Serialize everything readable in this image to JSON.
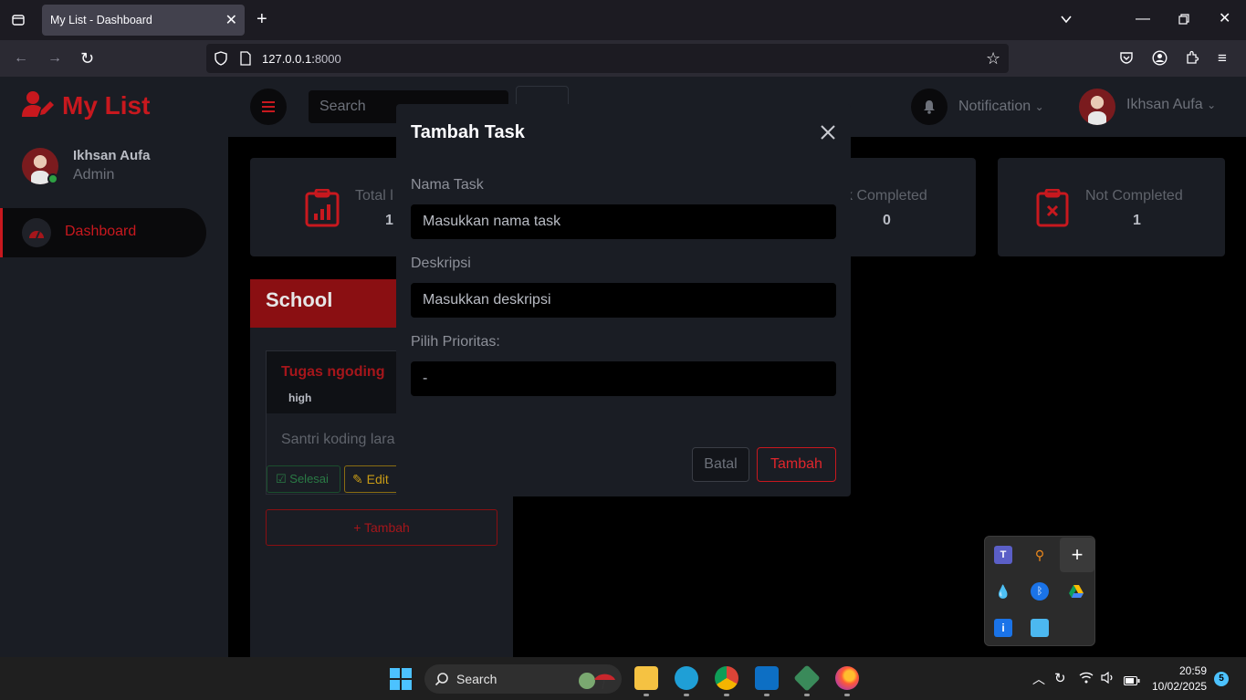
{
  "browser": {
    "tab_title": "My List - Dashboard",
    "url_host": "127.0.0.1:",
    "url_port": "8000"
  },
  "sidebar": {
    "brand": "My List",
    "user_name": "Ikhsan Aufa",
    "user_role": "Admin",
    "nav": [
      {
        "label": "Dashboard",
        "active": true
      }
    ]
  },
  "topbar": {
    "search_placeholder": "Search",
    "notification_label": "Notification",
    "user_name": "Ikhsan Aufa"
  },
  "stats": [
    {
      "label": "Total l",
      "value": "1"
    },
    {
      "label": "sk Completed",
      "value": "0"
    },
    {
      "label": "Not Completed",
      "value": "1"
    }
  ],
  "list": {
    "title": "School",
    "task": {
      "title": "Tugas ngoding",
      "priority": "high",
      "description": "Santri koding lara",
      "done_label": "Selesai",
      "edit_label": "Edit"
    },
    "add_label": "+ Tambah"
  },
  "modal": {
    "title": "Tambah Task",
    "name_label": "Nama Task",
    "name_placeholder": "Masukkan nama task",
    "desc_label": "Deskripsi",
    "desc_placeholder": "Masukkan deskripsi",
    "priority_label": "Pilih Prioritas:",
    "priority_value": "-",
    "cancel_label": "Batal",
    "submit_label": "Tambah"
  },
  "taskbar": {
    "search_label": "Search",
    "time": "20:59",
    "date": "10/02/2025",
    "notification_count": "5"
  },
  "colors": {
    "accent": "#c8181e",
    "panel": "#1a1d24",
    "background": "#000000"
  }
}
